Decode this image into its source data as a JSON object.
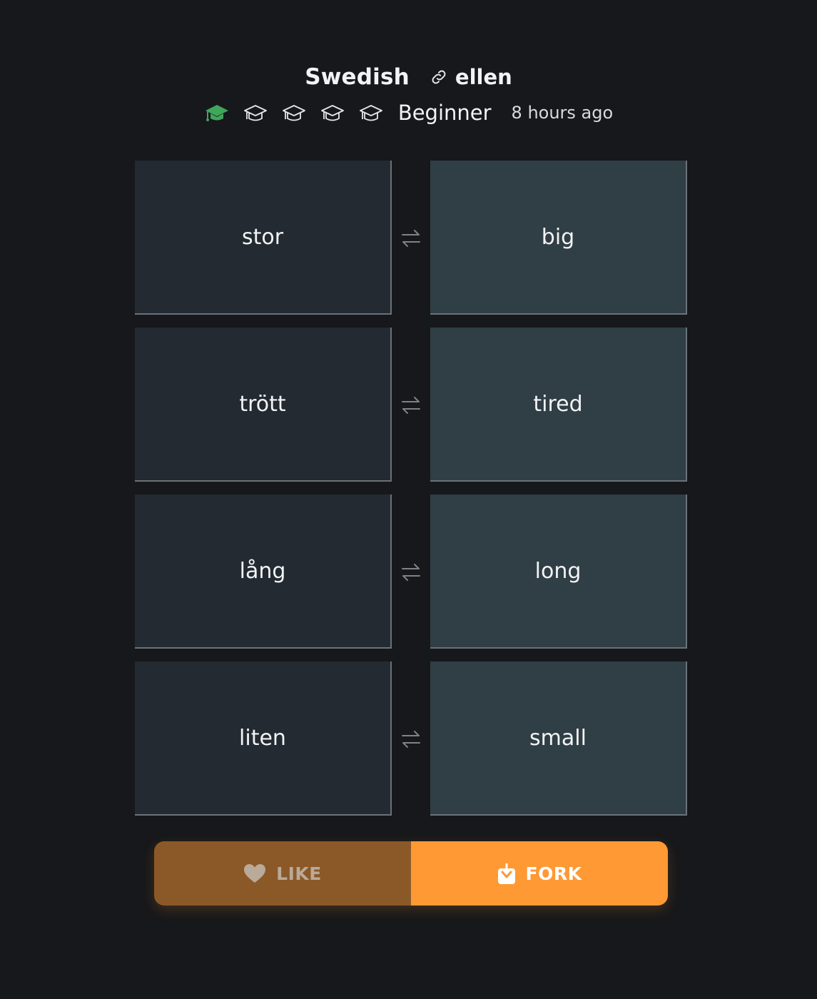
{
  "deck": {
    "title": "Swedish",
    "author": "ellen",
    "level_label": "Beginner",
    "level_value": 1,
    "level_max": 5,
    "timestamp": "8 hours ago"
  },
  "cards": [
    {
      "front": "stor",
      "back": "big"
    },
    {
      "front": "trött",
      "back": "tired"
    },
    {
      "front": "lång",
      "back": "long"
    },
    {
      "front": "liten",
      "back": "small"
    }
  ],
  "actions": {
    "like_label": "LIKE",
    "fork_label": "FORK"
  },
  "icons": {
    "author": "link-icon",
    "level": "graduation-cap-icon",
    "swap": "swap-arrows-icon",
    "like": "heart-icon",
    "fork": "download-box-icon"
  },
  "colors": {
    "background": "#17181b",
    "card_front": "#232a31",
    "card_back": "#303e45",
    "level_active": "#3fa65a",
    "like_bg": "#8b5927",
    "fork_bg": "#ff9933"
  }
}
